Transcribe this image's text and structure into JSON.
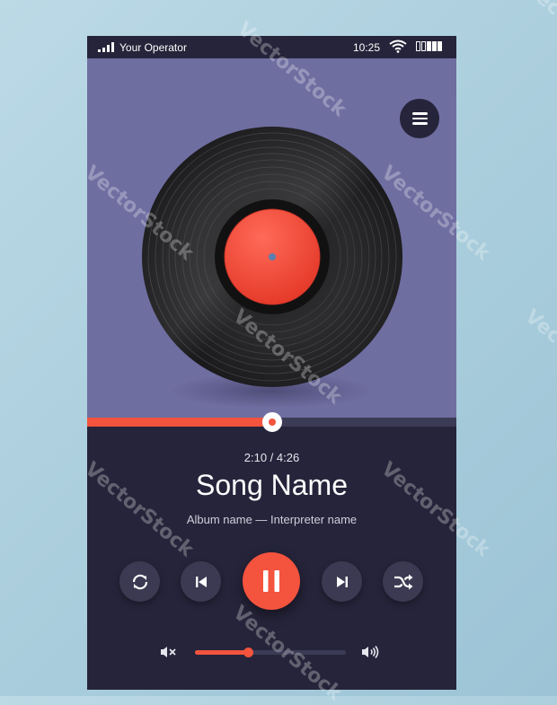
{
  "status_bar": {
    "operator": "Your Operator",
    "time": "10:25",
    "signal_icon": "signal-bars-icon",
    "wifi_icon": "wifi-icon",
    "battery_icon": "battery-icon"
  },
  "header": {
    "menu_icon": "hamburger-menu-icon"
  },
  "album_art": {
    "icon": "vinyl-record",
    "label_color": "#f0493a"
  },
  "playback": {
    "progress_fraction": 0.5,
    "time_text": "2:10 / 4:26",
    "song_title": "Song Name",
    "subtitle": "Album name — Interpreter name"
  },
  "controls": {
    "repeat_icon": "repeat-icon",
    "previous_icon": "skip-previous-icon",
    "play_pause_icon": "pause-icon",
    "next_icon": "skip-next-icon",
    "shuffle_icon": "shuffle-icon"
  },
  "volume": {
    "level_fraction": 0.35,
    "mute_icon": "volume-mute-icon",
    "max_icon": "volume-max-icon"
  },
  "colors": {
    "accent": "#f4533e",
    "panel": "#26243a",
    "hero": "#6f6ea1",
    "background": "#a9cddc"
  },
  "watermark": "VectorStock"
}
